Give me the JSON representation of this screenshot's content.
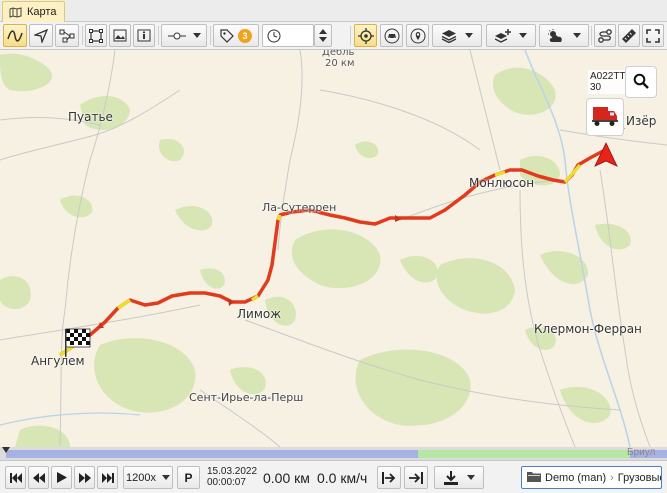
{
  "tab": {
    "label": "Карта"
  },
  "toolbar": {
    "badge_count": "3"
  },
  "map": {
    "labels": {
      "puatye": "Пуатье",
      "debl": "Дебль",
      "debl_dist": "20 км",
      "izer": "Изёр",
      "monlyuson": "Монлюсон",
      "la_suterren": "Ла-Сутеррен",
      "limozh": "Лимож",
      "klermon": "Клермон-Ферран",
      "angulem": "Ангулем",
      "sent_irye": "Сент-Ирье-ла-Перш"
    },
    "vehicle": {
      "plate": "A022TT",
      "sub": "30"
    }
  },
  "timeline": {
    "right_text": "Бриул"
  },
  "bottom": {
    "speed_select": "1200x",
    "p_label": "P",
    "date": "15.03.2022",
    "time": "00:00:07",
    "distance": "0.00 км",
    "speed": "0.0 км/ч",
    "group_owner": "Demo (man)",
    "group_name": "Грузовые"
  },
  "colors": {
    "track": "#e23a1c",
    "forest": "#d6e5b4",
    "accent": "#f0a21c",
    "water": "#b9d3ea"
  }
}
